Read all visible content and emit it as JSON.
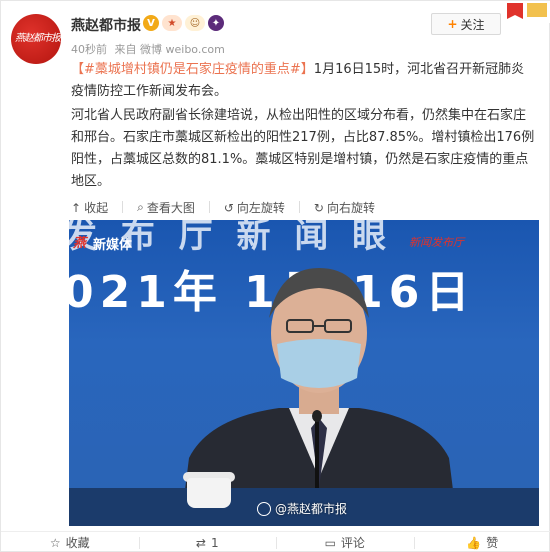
{
  "account": {
    "name": "燕赵都市报",
    "avatar_text": "燕赵都市报",
    "time": "40秒前",
    "source": "来自 微博 weibo.com"
  },
  "follow": {
    "label": "关注",
    "plus": "+"
  },
  "post": {
    "topic": "【#藁城增村镇仍是石家庄疫情的重点#】",
    "para1_rest": "1月16日15时，河北省召开新冠肺炎疫情防控工作新闻发布会。",
    "para2": "河北省人民政府副省长徐建培说，从检出阳性的区域分布看，仍然集中在石家庄和邢台。石家庄市藁城区新检出的阳性217例，占比87.85%。增村镇检出176例阳性，占藁城区总数的81.1%。藁城区特别是增村镇，仍然是石家庄疫情的重点地区。"
  },
  "toolbar": {
    "collapse": "收起",
    "view_large": "查看大图",
    "rotate_left": "向左旋转",
    "rotate_right": "向右旋转"
  },
  "photo": {
    "top_text": "发 布 厅 新 闻 眼",
    "logo_red": "燕",
    "logo_sub": "新媒体",
    "logo_right": "新闻发布厅",
    "date_text": "021年 1月 16日",
    "watermark": "@燕赵都市报"
  },
  "footer": {
    "favorite": "收藏",
    "repost": "1",
    "comment": "评论",
    "like": "赞"
  },
  "colors": {
    "topic": "#eb7350",
    "follow_plus": "#ff8200",
    "verified_badge": "#f2a917"
  }
}
